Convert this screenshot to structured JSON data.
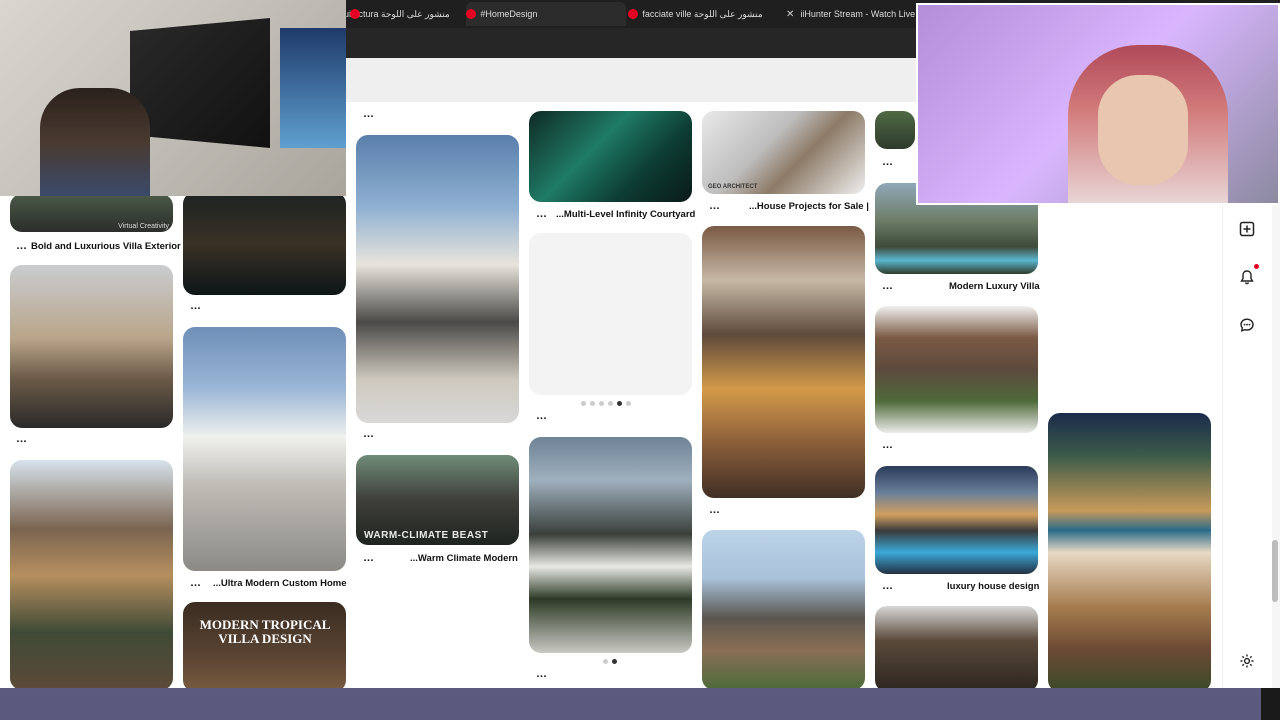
{
  "tabs": [
    {
      "label": "uitectura منشور على اللوحة"
    },
    {
      "label": "#HomeDesign"
    },
    {
      "label": "facciate ville منشور على اللوحة"
    },
    {
      "label": "iiHunter Stream - Watch Live o"
    }
  ],
  "pins": {
    "villa_exterior": {
      "title": "Bold and Luxurious Villa Exterior"
    },
    "ultra_modern": {
      "title": "...Ultra Modern Custom Home"
    },
    "tropical": {
      "title": "MODERN TROPICAL VILLA DESIGN"
    },
    "warm_climate": {
      "title": "...Warm Climate Modern",
      "overlay": "WARM-CLIMATE BEAST"
    },
    "infinity": {
      "title": "...Multi-Level Infinity Courtyard"
    },
    "house_projects": {
      "title": "...House Projects for Sale |"
    },
    "modern_luxury": {
      "title": "Modern Luxury Villa"
    },
    "luxury_house": {
      "title": "luxury house design"
    },
    "watermark": {
      "text": "Virtual Creativity"
    },
    "logo": {
      "text": "GEO ARCHITECT"
    }
  },
  "more_glyph": "…",
  "carousel1": {
    "count": 6,
    "active": 5
  },
  "carousel2": {
    "count": 2,
    "active": 2
  },
  "colors": {
    "accent": "#e60023",
    "tabbar": "#1f1f1f"
  }
}
